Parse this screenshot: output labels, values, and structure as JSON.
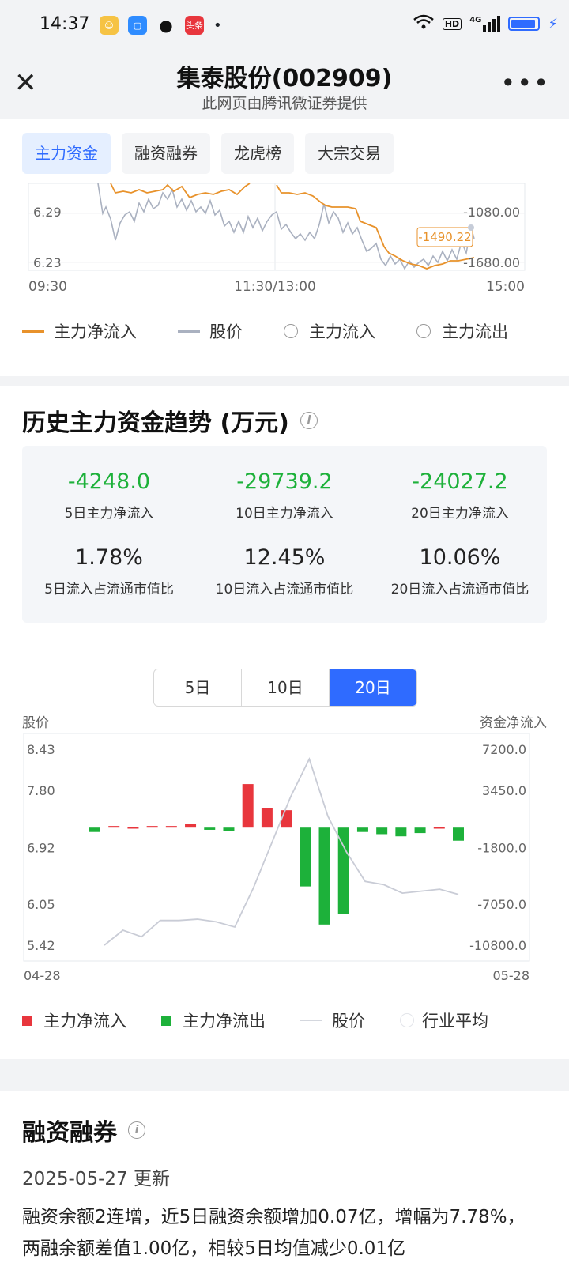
{
  "status_bar": {
    "time": "14:37",
    "notification_icons": [
      "kid-app-icon",
      "blue-app-icon",
      "wechat-icon",
      "toutiao-icon"
    ],
    "toutiao_label": "头条",
    "dot": "•",
    "network": "4G",
    "hd": "HD"
  },
  "nav": {
    "title": "集泰股份(002909)",
    "subtitle": "此网页由腾讯微证券提供",
    "close": "✕",
    "more": "•••"
  },
  "tabs": [
    "主力资金",
    "融资融券",
    "龙虎榜",
    "大宗交易"
  ],
  "intraday": {
    "price_ticks": [
      "6.29",
      "6.23"
    ],
    "flow_ticks": [
      "-1080.00",
      "-1680.00"
    ],
    "time_labels": [
      "09:30",
      "11:30/13:00",
      "15:00"
    ],
    "last_value_tag": "-1490.22",
    "legend": {
      "net_inflow": "主力净流入",
      "price": "股价",
      "inflow": "主力流入",
      "outflow": "主力流出"
    },
    "colors": {
      "net_inflow": "#e8922b",
      "price": "#aab1c0"
    }
  },
  "history": {
    "title": "历史主力资金趋势 (万元)",
    "stats": [
      {
        "value": "-4248.0",
        "label": "5日主力净流入"
      },
      {
        "value": "-29739.2",
        "label": "10日主力净流入"
      },
      {
        "value": "-24027.2",
        "label": "20日主力净流入"
      },
      {
        "value": "1.78%",
        "label": "5日流入占流通市值比"
      },
      {
        "value": "12.45%",
        "label": "10日流入占流通市值比"
      },
      {
        "value": "10.06%",
        "label": "20日流入占流通市值比"
      }
    ],
    "periods": [
      "5日",
      "10日",
      "20日"
    ],
    "active_period": "20日",
    "left_axis_title": "股价",
    "right_axis_title": "资金净流入",
    "legend": {
      "inflow": "主力净流入",
      "outflow": "主力净流出",
      "price": "股价",
      "industry": "行业平均"
    }
  },
  "chart_data": {
    "type": "bar",
    "x_start": "04-28",
    "x_end": "05-28",
    "price_ticks": [
      "8.43",
      "7.80",
      "6.92",
      "6.05",
      "5.42"
    ],
    "flow_ticks": [
      "7200.0",
      "3450.0",
      "-1800.0",
      "-7050.0",
      "-10800.0"
    ],
    "ylim_price": [
      5.42,
      8.43
    ],
    "ylim_flow": [
      -10800,
      7200
    ],
    "series": [
      {
        "name": "主力净流入",
        "type": "bar",
        "values": [
          -400,
          150,
          50,
          150,
          150,
          350,
          -200,
          -300,
          4000,
          1800,
          1600,
          -5400,
          -8900,
          -7900,
          -400,
          -600,
          -800,
          -500,
          50,
          -1200
        ]
      },
      {
        "name": "股价",
        "type": "line",
        "values": [
          5.42,
          5.65,
          5.55,
          5.8,
          5.8,
          5.82,
          5.78,
          5.7,
          6.3,
          7.0,
          7.7,
          8.28,
          7.4,
          6.85,
          6.4,
          6.35,
          6.22,
          6.25,
          6.28,
          6.2
        ]
      }
    ],
    "colors": {
      "inflow": "#e8363d",
      "outflow": "#1db13a",
      "price": "#c9ccd6"
    }
  },
  "margin": {
    "title": "融资融券",
    "date": "2025-05-27 更新",
    "desc": "融资余额2连增，近5日融资余额增加0.07亿，增幅为7.78%，两融余额差值1.00亿，相较5日均值减少0.01亿"
  }
}
